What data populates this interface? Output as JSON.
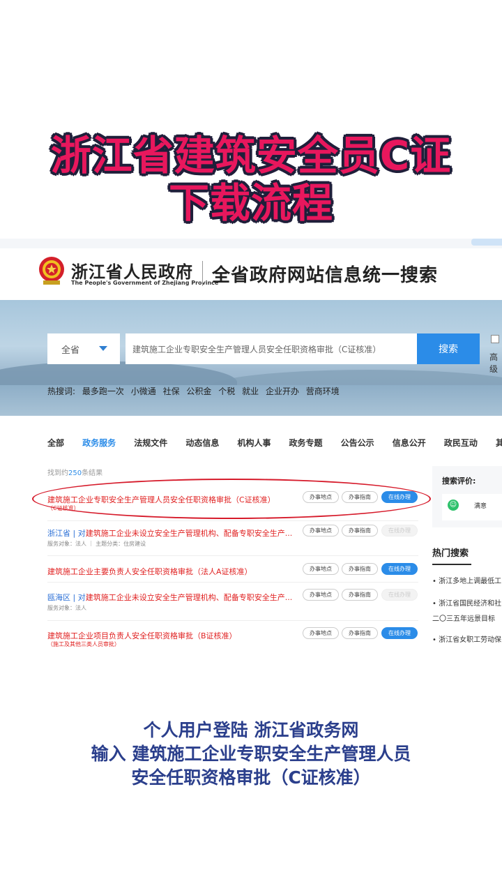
{
  "overlay": {
    "title_line1": "浙江省建筑安全员C证",
    "title_line2": "下载流程",
    "caption_line1": "个人用户登陆 浙江省政务网",
    "caption_line2": "输入 建筑施工企业专职安全生产管理人员",
    "caption_line3": "安全任职资格审批（C证核准）"
  },
  "header": {
    "gov_name_cn": "浙江省人民政府",
    "gov_name_en": "The People's Government of Zhejiang Province",
    "site_title": "全省政府网站信息统一搜索"
  },
  "search": {
    "scope": "全省",
    "query": "建筑施工企业专职安全生产管理人员安全任职资格审批（C证核准）",
    "button": "搜索",
    "advanced": "高级"
  },
  "hot_terms": {
    "label": "热搜词:",
    "items": [
      "最多跑一次",
      "小微通",
      "社保",
      "公积金",
      "个税",
      "就业",
      "企业开办",
      "营商环境"
    ]
  },
  "tabs": [
    "全部",
    "政务服务",
    "法规文件",
    "动态信息",
    "机构人事",
    "政务专题",
    "公告公示",
    "信息公开",
    "政民互动",
    "其他"
  ],
  "result_count": {
    "prefix": "找到约",
    "number": "250",
    "suffix": "条结果"
  },
  "results": [
    {
      "title": "建筑施工企业专职安全生产管理人员安全任职资格审批（C证核准）",
      "sub": "（C证核准）",
      "btn1": "办事地点",
      "btn2": "办事指南",
      "btn3": "在线办理"
    },
    {
      "prefix": "浙江省 | 对",
      "title": "建筑施工企业未设立安全生产管理机构、配备专职安全生产...",
      "sub": "服务对象：法人 ｜ 主题分类：住房建设",
      "btn1": "办事地点",
      "btn2": "办事指南",
      "btn3": "在线办理"
    },
    {
      "title": "建筑施工企业主要负责人安全任职资格审批（法人A证核准）",
      "btn1": "办事地点",
      "btn2": "办事指南",
      "btn3": "在线办理"
    },
    {
      "prefix": "瓯海区 | 对",
      "title": "建筑施工企业未设立安全生产管理机构、配备专职安全生产...",
      "sub": "服务对象：法人",
      "btn1": "办事地点",
      "btn2": "办事指南",
      "btn3": "在线办理"
    },
    {
      "title": "建筑施工企业项目负责人安全任职资格审批（B证核准）",
      "sub": "（施工及其他三类人员审批）",
      "btn1": "办事地点",
      "btn2": "办事指南",
      "btn3": "在线办理"
    }
  ],
  "sidebar": {
    "eval_label": "搜索评价:",
    "satisfied": "满意",
    "hot_search_title": "热门搜索",
    "hot_items": [
      "浙江多地上调最低工",
      "浙江省国民经济和社",
      "二〇三五年远景目标",
      "浙江省女职工劳动保"
    ]
  }
}
